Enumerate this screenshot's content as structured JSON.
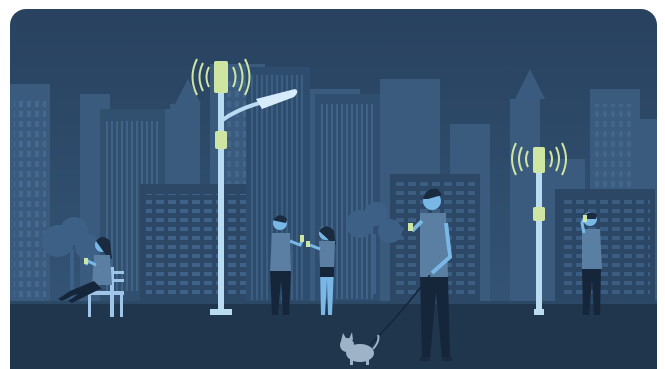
{
  "scene": {
    "colors": {
      "sky_top": "#2a4566",
      "sky_bottom": "#345478",
      "far_buildings": "#3c5e82",
      "mid_buildings": "#2f4d6f",
      "near_buildings": "#284462",
      "windows": "#4a6f95",
      "ground": "#22384f",
      "pole": "#b9dcf2",
      "antenna": "#cfe6a2",
      "lamp": "#d6ecfb",
      "skin": "#79b7e6",
      "shirt": "#5a7fa3",
      "pants": "#16263a",
      "hair": "#1a2a3f",
      "tree": "#3f6388",
      "bench": "#9fc6e8"
    },
    "icons": [
      "signal-waves-icon",
      "cell-tower-icon",
      "street-lamp-icon",
      "smartphone-icon",
      "dog-icon",
      "bench-icon",
      "tree-icon"
    ]
  }
}
